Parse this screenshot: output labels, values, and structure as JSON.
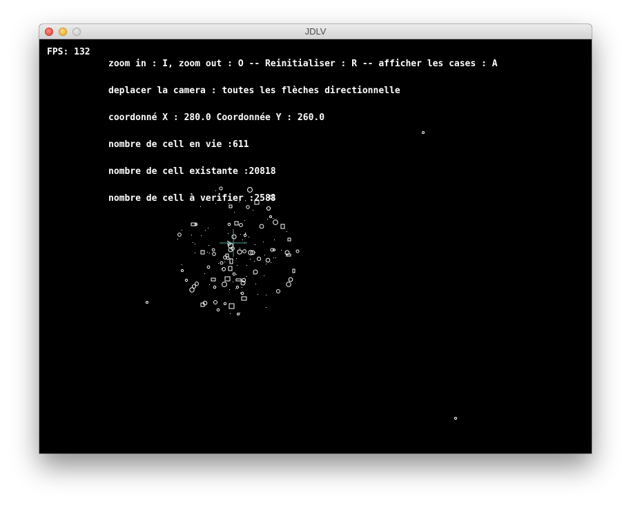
{
  "window": {
    "title": "JDLV"
  },
  "hud": {
    "fps": "FPS: 132",
    "lines": [
      "zoom in : I, zoom out : O -- Reinitialiser : R -- afficher les cases : A",
      "deplacer la camera : toutes les flèches directionnelle",
      "coordonné X : 280.0 Coordonnée Y : 260.0",
      "nombre de cell en vie :611",
      "nombre de cell existante :20818",
      "nombre de cell à verifier :2588"
    ]
  },
  "colors": {
    "background": "#000000",
    "cells": "#ffffff",
    "crosshair": "#4fa8a0"
  }
}
